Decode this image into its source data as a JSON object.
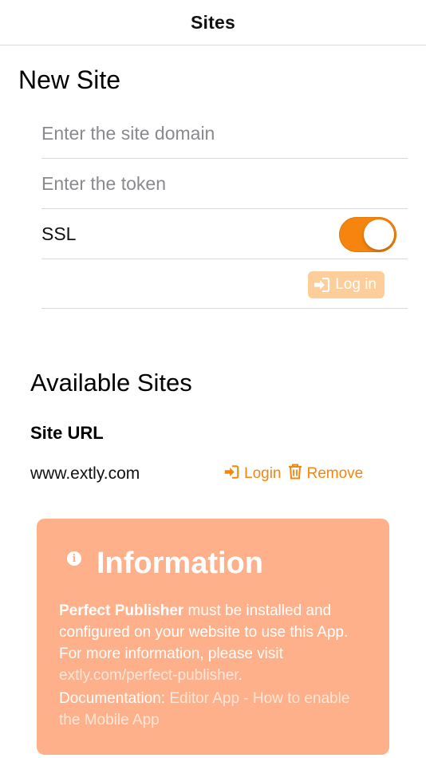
{
  "nav": {
    "title": "Sites"
  },
  "new_site": {
    "title": "New Site",
    "domain_placeholder": "Enter the site domain",
    "token_placeholder": "Enter the token",
    "ssl_label": "SSL",
    "ssl_enabled": true,
    "login_label": "Log in"
  },
  "available": {
    "title": "Available Sites",
    "column_header": "Site URL",
    "sites": [
      {
        "url": "www.extly.com",
        "login_label": "Login",
        "remove_label": "Remove"
      }
    ]
  },
  "info": {
    "title": "Information",
    "product": "Perfect Publisher",
    "text": " must be installed and configured on your website to use this App. For more information, please visit ",
    "link": "extly.com/perfect-publisher",
    "link_suffix": ".",
    "doc_label": "Documentation: ",
    "doc_link": "Editor App - How to enable the Mobile App"
  },
  "colors": {
    "accent": "#f5850f",
    "info_background": "#feb08a",
    "login_button_disabled": "#fdcd9a"
  },
  "icons": {
    "login": "sign-in-icon",
    "remove": "trash-icon",
    "info": "info-circle-icon"
  }
}
